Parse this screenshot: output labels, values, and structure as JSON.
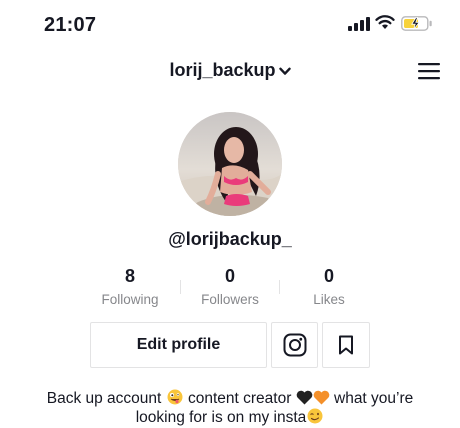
{
  "status_bar": {
    "time": "21:07",
    "icons": [
      "cellular-signal-icon",
      "wifi-icon",
      "battery-charging-icon"
    ],
    "battery_color": "#f7d23b"
  },
  "header": {
    "username": "lorij_backup",
    "menu_icon": "hamburger-menu-icon"
  },
  "profile": {
    "handle": "@lorijbackup_",
    "stats": [
      {
        "value": "8",
        "label": "Following"
      },
      {
        "value": "0",
        "label": "Followers"
      },
      {
        "value": "0",
        "label": "Likes"
      }
    ]
  },
  "actions": {
    "edit_profile_label": "Edit profile",
    "instagram_icon": "instagram-icon",
    "bookmark_icon": "bookmark-icon"
  },
  "bio": {
    "part1": "Back up account",
    "part2": "content creator",
    "part3": "what you’re",
    "part4": "looking for is on my insta",
    "emojis": [
      "zany-face-emoji",
      "black-heart-emoji",
      "orange-heart-emoji",
      "winking-face-emoji"
    ]
  },
  "colors": {
    "text": "#161823",
    "secondary_text": "#86878b",
    "border": "#e3e3e4"
  }
}
